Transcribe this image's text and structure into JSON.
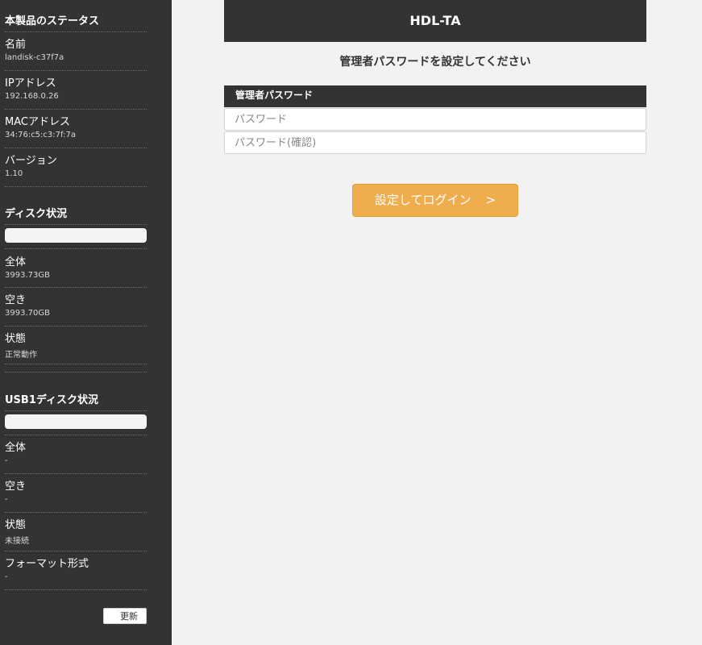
{
  "sidebar": {
    "status_section": {
      "title": "本製品のステータス",
      "items": [
        {
          "label": "名前",
          "value": "landisk-c37f7a"
        },
        {
          "label": "IPアドレス",
          "value": "192.168.0.26"
        },
        {
          "label": "MACアドレス",
          "value": "34:76:c5:c3:7f:7a"
        },
        {
          "label": "バージョン",
          "value": "1.10"
        }
      ]
    },
    "disk_section": {
      "title": "ディスク状況",
      "usage_fraction": 0.0,
      "items": [
        {
          "label": "全体",
          "value": "3993.73GB"
        },
        {
          "label": "空き",
          "value": "3993.70GB"
        },
        {
          "label": "状態",
          "value": "正常動作"
        }
      ]
    },
    "usb_section": {
      "title": "USB1ディスク状況",
      "usage_fraction": 0.0,
      "items": [
        {
          "label": "全体",
          "value": "-"
        },
        {
          "label": "空き",
          "value": "-"
        },
        {
          "label": "状態",
          "value": "未接続"
        },
        {
          "label": "フォーマット形式",
          "value": "-"
        }
      ]
    },
    "refresh_label": "更新"
  },
  "main": {
    "header_title": "HDL-TA",
    "subtitle": "管理者パスワードを設定してください",
    "field_label": "管理者パスワード",
    "password_placeholder": "パスワード",
    "password_confirm_placeholder": "パスワード(確認)",
    "login_label": "設定してログイン",
    "login_arrow": ">"
  },
  "colors": {
    "sidebar_bg": "#333333",
    "page_bg": "#f2f2f2",
    "header_bg": "#333333",
    "button_accent": "#f0ad4e"
  }
}
